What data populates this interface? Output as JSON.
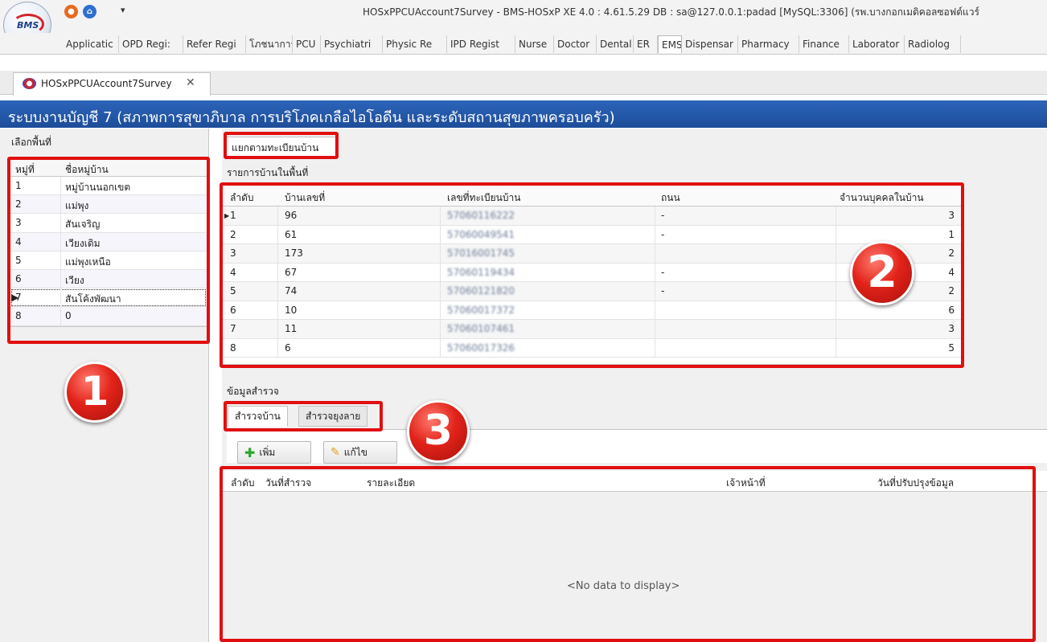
{
  "window": {
    "title": "HOSxPPCUAccount7Survey - BMS-HOSxP XE 4.0 : 4.61.5.29 DB : sa@127.0.0.1:padad [MySQL:3306] (รพ.บางกอกเมดิคอลซอฟต์แวร์",
    "logo_text": "BMS"
  },
  "ribbon_tabs": [
    {
      "label": "Applicatic"
    },
    {
      "label": "OPD Regi:"
    },
    {
      "label": "Refer Regi"
    },
    {
      "label": "โภชนาการ"
    },
    {
      "label": "PCU"
    },
    {
      "label": "Psychiatri"
    },
    {
      "label": "Physic Re"
    },
    {
      "label": "IPD Regist"
    },
    {
      "label": "Nurse"
    },
    {
      "label": "Doctor"
    },
    {
      "label": "Dental"
    },
    {
      "label": "ER"
    },
    {
      "label": "EMS",
      "active": true
    },
    {
      "label": "Dispensar"
    },
    {
      "label": "Pharmacy"
    },
    {
      "label": "Finance"
    },
    {
      "label": "Laborator"
    },
    {
      "label": "Radiolog"
    }
  ],
  "doc_tab": {
    "label": "HOSxPPCUAccount7Survey"
  },
  "header": {
    "title": "ระบบงานบัญชี 7 (สภาพการสุขาภิบาล การบริโภคเกลือไอโอดีน และระดับสถานสุขภาพครอบครัว)"
  },
  "left": {
    "caption": "เลือกพื้นที่",
    "columns": [
      "หมู่ที่",
      "ชื่อหมู่บ้าน"
    ],
    "rows": [
      {
        "no": "1",
        "name": "หมู่บ้านนอกเขต"
      },
      {
        "no": "2",
        "name": "แม่พุง"
      },
      {
        "no": "3",
        "name": "สันเจริญ"
      },
      {
        "no": "4",
        "name": "เวียงเดิม"
      },
      {
        "no": "5",
        "name": "แม่พุงเหนือ"
      },
      {
        "no": "6",
        "name": "เวียง"
      },
      {
        "no": "7",
        "name": "สันโค้งพัฒนา"
      },
      {
        "no": "8",
        "name": "0"
      }
    ]
  },
  "right": {
    "split_tab": "แยกตามทะเบียนบ้าน",
    "house_caption": "รายการบ้านในพื้นที่",
    "house_columns": [
      "ลำดับ",
      "บ้านเลขที่",
      "เลขที่ทะเบียนบ้าน",
      "ถนน",
      "จำนวนบุคคลในบ้าน"
    ],
    "houses": [
      {
        "seq": "1",
        "house_no": "96",
        "reg_no": "57060116222",
        "road": "-",
        "persons": "3"
      },
      {
        "seq": "2",
        "house_no": "61",
        "reg_no": "57060049541",
        "road": "-",
        "persons": "1"
      },
      {
        "seq": "3",
        "house_no": "173",
        "reg_no": "57016001745",
        "road": "",
        "persons": "2"
      },
      {
        "seq": "4",
        "house_no": "67",
        "reg_no": "57060119434",
        "road": "-",
        "persons": "4"
      },
      {
        "seq": "5",
        "house_no": "74",
        "reg_no": "57060121820",
        "road": "-",
        "persons": "2"
      },
      {
        "seq": "6",
        "house_no": "10",
        "reg_no": "57060017372",
        "road": "",
        "persons": "6"
      },
      {
        "seq": "7",
        "house_no": "11",
        "reg_no": "57060107461",
        "road": "",
        "persons": "3"
      },
      {
        "seq": "8",
        "house_no": "6",
        "reg_no": "57060017326",
        "road": "",
        "persons": "5"
      }
    ],
    "survey_caption": "ข้อมูลสำรวจ",
    "survey_tabs": [
      "สำรวจบ้าน",
      "สำรวจยุงลาย"
    ],
    "buttons": {
      "add": "เพิ่ม",
      "edit": "แก้ไข"
    },
    "survey_columns": [
      "ลำดับ",
      "วันที่สำรวจ",
      "รายละเอียด",
      "เจ้าหน้าที่",
      "วันที่ปรับปรุงข้อมูล"
    ],
    "no_data": "<No data to display>"
  },
  "badges": [
    "1",
    "2",
    "3"
  ],
  "colors": {
    "header_blue": "#1d4d99",
    "highlight_red": "#e10f0f"
  }
}
